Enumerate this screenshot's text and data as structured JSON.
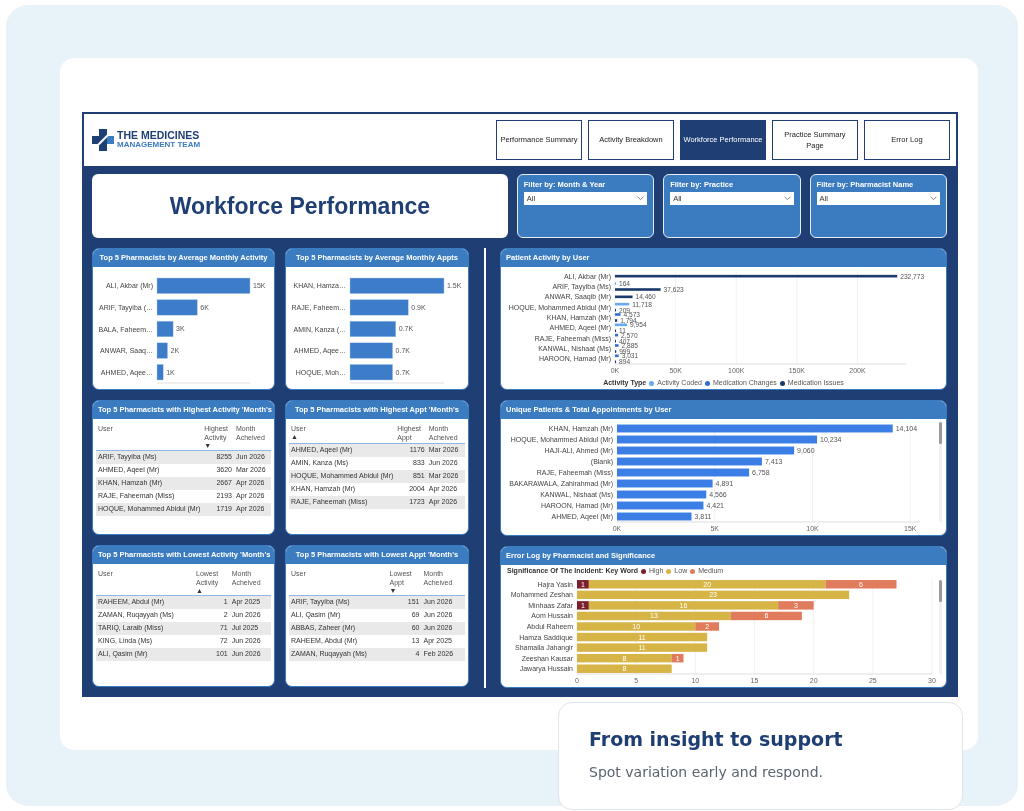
{
  "header": {
    "logo": {
      "line_1": "THE MEDICINES",
      "line_2": "MANAGEMENT TEAM"
    },
    "tabs": [
      {
        "label": "Performance Summary",
        "selected": false
      },
      {
        "label": "Activity Breakdown",
        "selected": false
      },
      {
        "label": "Workforce Performance",
        "selected": true
      },
      {
        "label": "Practice Summary Page",
        "selected": false
      },
      {
        "label": "Error Log",
        "selected": false
      }
    ]
  },
  "title": "Workforce Performance",
  "filters": [
    {
      "label": "Filter by: Month & Year",
      "value": "All"
    },
    {
      "label": "Filter by: Practice",
      "value": "All"
    },
    {
      "label": "Filter by: Pharmacist Name",
      "value": "All"
    }
  ],
  "bar_cards": [
    {
      "title": "Top 5 Pharmacists by Average Monthly Activity",
      "chart_data": {
        "type": "bar",
        "orientation": "horizontal",
        "categories": [
          "ALI, Akbar (Mr)",
          "ARIF, Tayyiba (…",
          "BALA, Faheem…",
          "ANWAR, Saaq…",
          "AHMED, Aqee…"
        ],
        "values": [
          15000,
          6500,
          2600,
          1700,
          1000
        ],
        "value_labels": [
          "15K",
          "6K",
          "3K",
          "2K",
          "1K"
        ]
      }
    },
    {
      "title": "Top 5 Pharmacists by Average Monthly Appts",
      "chart_data": {
        "type": "bar",
        "orientation": "horizontal",
        "categories": [
          "KHAN, Hamza…",
          "RAJE, Faheem…",
          "AMIN, Kanza (…",
          "AHMED, Aqee…",
          "HOQUE, Moh…"
        ],
        "values": [
          1500,
          930,
          730,
          680,
          680
        ],
        "value_labels": [
          "1.5K",
          "0.9K",
          "0.7K",
          "0.7K",
          "0.7K"
        ]
      }
    }
  ],
  "table_cards": [
    {
      "title": "Top 5 Pharmacists with Highest Activity 'Month's",
      "columns": [
        {
          "label": "User"
        },
        {
          "label": "Highest Activity",
          "sort_mark": "▼"
        },
        {
          "label": "Month Acheived"
        }
      ],
      "rows": [
        [
          "ARIF, Tayyiba (Ms)",
          "8255",
          "Jun 2026"
        ],
        [
          "AHMED, Aqeel (Mr)",
          "3620",
          "Mar 2026"
        ],
        [
          "KHAN, Hamzah (Mr)",
          "2667",
          "Apr 2026"
        ],
        [
          "RAJE, Faheemah (Miss)",
          "2193",
          "Apr 2026"
        ],
        [
          "HOQUE, Mohammed Abidul (Mr)",
          "1719",
          "Apr 2026"
        ]
      ]
    },
    {
      "title": "Top 5 Pharmacists with Highest Appt 'Month's",
      "columns": [
        {
          "label": "User",
          "sort_mark": "▲"
        },
        {
          "label": "Highest Appt"
        },
        {
          "label": "Month Acheived"
        }
      ],
      "rows": [
        [
          "AHMED, Aqeel (Mr)",
          "1176",
          "Mar 2026"
        ],
        [
          "AMIN, Kanza (Ms)",
          "833",
          "Jun 2026"
        ],
        [
          "HOQUE, Mohammed Abidul (Mr)",
          "851",
          "Mar 2026"
        ],
        [
          "KHAN, Hamzah (Mr)",
          "2004",
          "Apr 2026"
        ],
        [
          "RAJE, Faheemah (Miss)",
          "1723",
          "Apr 2026"
        ]
      ]
    },
    {
      "title": "Top 5 Pharmacists with Lowest Activity 'Month's",
      "columns": [
        {
          "label": "User"
        },
        {
          "label": "Lowest Activity",
          "sort_mark": "▲"
        },
        {
          "label": "Month Acheived"
        }
      ],
      "rows": [
        [
          "RAHEEM, Abdul (Mr)",
          "1",
          "Apr 2025"
        ],
        [
          "ZAMAN, Ruqayyah (Ms)",
          "2",
          "Jun 2026"
        ],
        [
          "TARIQ, Laraib (Miss)",
          "71",
          "Jul 2025"
        ],
        [
          "KING, Linda (Ms)",
          "72",
          "Jun 2026"
        ],
        [
          "ALI, Qasim (Mr)",
          "101",
          "Jun 2026"
        ]
      ]
    },
    {
      "title": "Top 5 Pharmacists with Lowest Appt 'Month's",
      "columns": [
        {
          "label": "User"
        },
        {
          "label": "Lowest Appt",
          "sort_mark": "▼"
        },
        {
          "label": "Month Acheived"
        }
      ],
      "rows": [
        [
          "ARIF, Tayyiba (Ms)",
          "151",
          "Jun 2026"
        ],
        [
          "ALI, Qasim (Mr)",
          "69",
          "Jun 2026"
        ],
        [
          "ABBAS, Zaheer (Mr)",
          "60",
          "Jun 2026"
        ],
        [
          "RAHEEM, Abdul (Mr)",
          "13",
          "Apr 2025"
        ],
        [
          "ZAMAN, Ruqayyah (Ms)",
          "4",
          "Feb 2026"
        ]
      ]
    }
  ],
  "patient_activity": {
    "title": "Patient Activity by User",
    "legend_title": "Activity Type",
    "chart_data": {
      "type": "bar",
      "orientation": "horizontal",
      "grid": true,
      "xlim": [
        0,
        240000
      ],
      "categories": [
        "ALI, Akbar (Mr)",
        "ARIF, Tayyiba (Ms)",
        "ANWAR, Saaqib (Mr)",
        "HOQUE, Mohammed Abidul (Mr)",
        "KHAN, Hamzah (Mr)",
        "AHMED, Aqeel (Mr)",
        "RAJE, Faheemah (Miss)",
        "KANWAL, Nishaat (Ms)",
        "HAROON, Hamad (Mr)"
      ],
      "series": [
        {
          "name": "Activity Coded",
          "color": "#6aa8f2",
          "values": [
            null,
            164,
            null,
            11718,
            null,
            9954,
            null,
            null,
            null
          ],
          "value_labels": [
            null,
            "164",
            null,
            "11,718",
            null,
            "9,954",
            null,
            null,
            null
          ]
        },
        {
          "name": "Medication Changes",
          "color": "#2f6fd0",
          "values": [
            null,
            null,
            null,
            null,
            4573,
            null,
            2570,
            2885,
            3031
          ],
          "value_labels": [
            null,
            null,
            null,
            null,
            "4,573",
            null,
            "2,570",
            "2,885",
            "3,031"
          ]
        },
        {
          "name": "Medication Issues",
          "color": "#1b3a6b",
          "values": [
            232773,
            37623,
            14460,
            209,
            1794,
            11,
            407,
            999,
            894
          ],
          "value_labels": [
            "232,773",
            "37,623",
            "14,460",
            "209",
            "1,794",
            "11",
            "407",
            "999",
            "894"
          ]
        }
      ],
      "xticks": [
        {
          "value": 0,
          "label": "0K"
        },
        {
          "value": 50000,
          "label": "50K"
        },
        {
          "value": 100000,
          "label": "100K"
        },
        {
          "value": 150000,
          "label": "150K"
        },
        {
          "value": 200000,
          "label": "200K"
        }
      ]
    }
  },
  "unique_patients": {
    "title": "Unique Patients & Total Appointments by User",
    "chart_data": {
      "type": "bar",
      "orientation": "horizontal",
      "grid": true,
      "xlim": [
        0,
        15500
      ],
      "categories": [
        "KHAN, Hamzah (Mr)",
        "HOQUE, Mohammed Abidul (Mr)",
        "HAJI-ALI, Ahmed (Mr)",
        "(Blank)",
        "RAJE, Faheemah (Miss)",
        "BAKARAWALA, Zahirahmad (Mr)",
        "KANWAL, Nishaat (Ms)",
        "HAROON, Hamad (Mr)",
        "AHMED, Aqeel (Mr)"
      ],
      "values": [
        14104,
        10234,
        9060,
        7413,
        6758,
        4891,
        4566,
        4421,
        3811
      ],
      "value_labels": [
        "14,104",
        "10,234",
        "9,060",
        "7,413",
        "6,758",
        "4,891",
        "4,566",
        "4,421",
        "3,811"
      ],
      "xticks": [
        {
          "value": 0,
          "label": "0K"
        },
        {
          "value": 5000,
          "label": "5K"
        },
        {
          "value": 10000,
          "label": "10K"
        },
        {
          "value": 15000,
          "label": "15K"
        }
      ]
    }
  },
  "error_log": {
    "title": "Error Log by Pharmacist and Significance",
    "legend_title": "Significance Of The Incident: Key Word",
    "chart_data": {
      "type": "bar",
      "orientation": "horizontal",
      "stacked": true,
      "grid": true,
      "xlim": [
        0,
        30
      ],
      "categories": [
        "Hajra Yasin",
        "Mohammed Zeshan",
        "Minhaas Zafar",
        "Aom Hussain",
        "Abdul Raheem",
        "Hamza Saddique",
        "Shamaila Jahangir",
        "Zeeshan Kausar",
        "Jawarya Hussain"
      ],
      "series": [
        {
          "name": "High",
          "color": "#7a1f2b",
          "values": [
            1,
            null,
            1,
            null,
            null,
            null,
            null,
            null,
            null
          ],
          "value_labels": [
            "1",
            null,
            "1",
            null,
            null,
            null,
            null,
            null,
            null
          ]
        },
        {
          "name": "Low",
          "color": "#d6b445",
          "values": [
            20,
            23,
            16,
            13,
            10,
            11,
            11,
            8,
            8
          ],
          "value_labels": [
            "20",
            "23",
            "16",
            "13",
            "10",
            "11",
            "11",
            "8",
            "8"
          ]
        },
        {
          "name": "Medium",
          "color": "#e07b5c",
          "values": [
            6,
            null,
            3,
            6,
            2,
            null,
            null,
            1,
            null
          ],
          "value_labels": [
            "6",
            null,
            "3",
            "6",
            "2",
            null,
            null,
            "1",
            null
          ]
        }
      ],
      "xticks": [
        0,
        5,
        10,
        15,
        20,
        25,
        30
      ]
    }
  },
  "caption": {
    "heading": "From insight to support",
    "text": "Spot variation early and respond."
  }
}
